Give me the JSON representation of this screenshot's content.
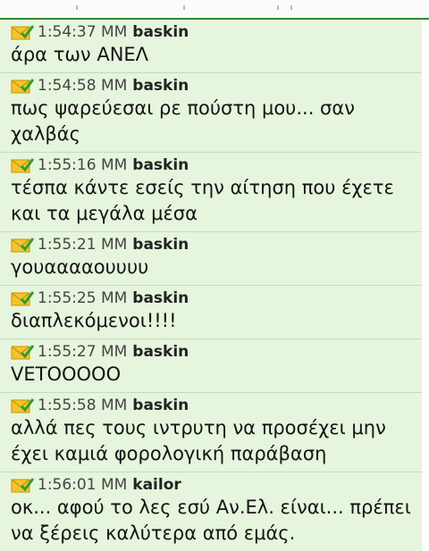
{
  "messages": [
    {
      "time": "1:54:37 MM",
      "user": "baskin",
      "text": "άρα των ΑΝΕΛ"
    },
    {
      "time": "1:54:58 MM",
      "user": "baskin",
      "text": "πως ψαρεύεσαι ρε πούστη μου... σαν χαλβάς"
    },
    {
      "time": "1:55:16 MM",
      "user": "baskin",
      "text": "τέσπα κάντε εσείς την αίτηση που έχετε και τα μεγάλα μέσα"
    },
    {
      "time": "1:55:21 MM",
      "user": "baskin",
      "text": "γουααααουυυυ"
    },
    {
      "time": "1:55:25 MM",
      "user": "baskin",
      "text": "διαπλεκόμενοι!!!!"
    },
    {
      "time": "1:55:27 MM",
      "user": "baskin",
      "text": "VETOOOOO"
    },
    {
      "time": "1:55:58 MM",
      "user": "baskin",
      "text": "αλλά πες τους ιντρυτη να προσέχει μην έχει καμιά φορολογική παράβαση"
    },
    {
      "time": "1:56:01 MM",
      "user": "kailor",
      "text": "οκ... αφού το λες εσύ Αν.Ελ. είναι... πρέπει να ξέρεις καλύτερα από εμάς."
    }
  ],
  "icons": {
    "message": "envelope-check-icon"
  },
  "colors": {
    "row_bg": "#e6f5dd",
    "divider": "#c7d9bf",
    "accent": "#2f8a2f"
  }
}
